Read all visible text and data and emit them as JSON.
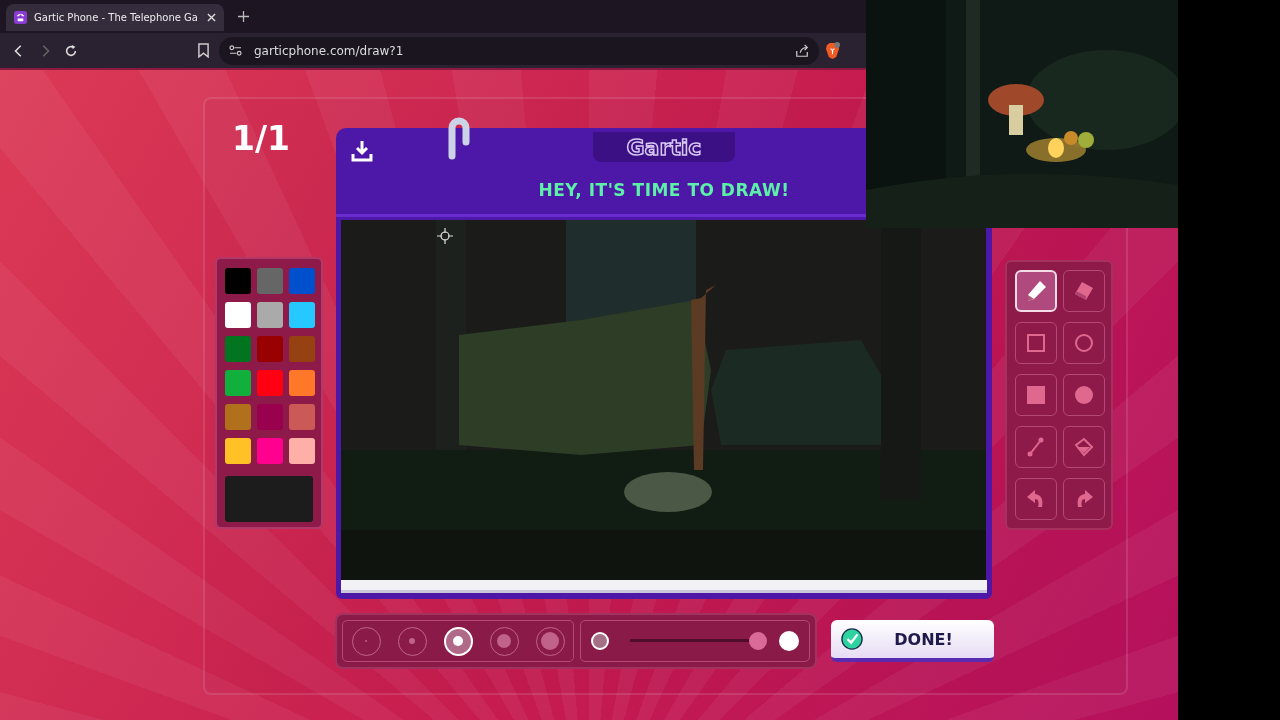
{
  "browser": {
    "tab": {
      "title": "Gartic Phone - The Telephone Ga"
    },
    "nav": [
      {
        "kind": "back",
        "disabled": false
      },
      {
        "kind": "forward",
        "disabled": true
      },
      {
        "kind": "reload",
        "disabled": false
      }
    ],
    "address": "garticphone.com/draw?1"
  },
  "game": {
    "round": "1/1",
    "logo": "Gartic",
    "prompt": "HEY, IT'S TIME TO DRAW!",
    "palette": [
      {
        "color": "#000000"
      },
      {
        "color": "#666666"
      },
      {
        "color": "#0050cd"
      },
      {
        "color": "#ffffff"
      },
      {
        "color": "#aaaaaa"
      },
      {
        "color": "#26c9ff"
      },
      {
        "color": "#017420"
      },
      {
        "color": "#990000"
      },
      {
        "color": "#964112"
      },
      {
        "color": "#11b03c"
      },
      {
        "color": "#ff0013"
      },
      {
        "color": "#ff7829"
      },
      {
        "color": "#b0701c"
      },
      {
        "color": "#99004e"
      },
      {
        "color": "#cb5a57"
      },
      {
        "color": "#ffc126"
      },
      {
        "color": "#ff008f"
      },
      {
        "color": "#feafa8"
      }
    ],
    "brush_sizes": [
      {
        "selected": false
      },
      {
        "selected": false
      },
      {
        "selected": true
      },
      {
        "selected": false
      },
      {
        "selected": false
      }
    ],
    "opacity": {
      "level": 1
    },
    "tools": [
      {
        "kind": "pencil",
        "selected": true
      },
      {
        "kind": "eraser",
        "selected": false
      },
      {
        "kind": "rectangle",
        "selected": false
      },
      {
        "kind": "ellipse",
        "selected": false
      },
      {
        "kind": "filled-rectangle",
        "selected": false
      },
      {
        "kind": "filled-ellipse",
        "selected": false
      },
      {
        "kind": "line",
        "selected": false
      },
      {
        "kind": "bucket",
        "selected": false
      },
      {
        "kind": "undo",
        "selected": false
      },
      {
        "kind": "redo",
        "selected": false
      }
    ],
    "done_button": "DONE!"
  }
}
